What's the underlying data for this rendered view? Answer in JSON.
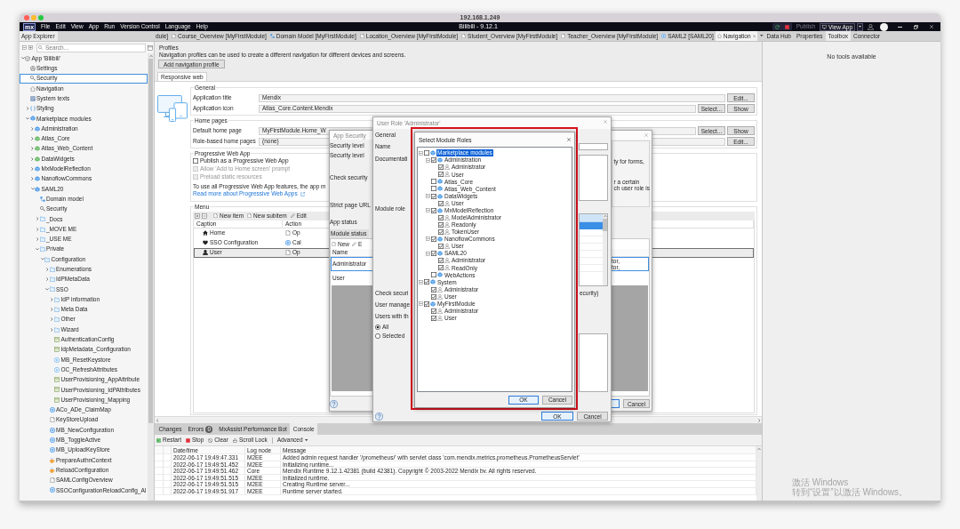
{
  "window": {
    "title": "192.168.1.249"
  },
  "menu_bar": {
    "logo": "mx",
    "items": [
      "File",
      "Edit",
      "View",
      "App",
      "Run",
      "Version Control",
      "Language",
      "Help"
    ],
    "app_title": "Bilibili - 9.12.1",
    "publish": {
      "label": "Publish",
      "disabled": true
    },
    "view_app": "View App"
  },
  "app_explorer": {
    "title": "App Explorer",
    "search": {
      "placeholder": "Search..."
    },
    "tree": [
      {
        "label": "App 'Bilibili'",
        "kind": "app",
        "expanded": true,
        "selected": false,
        "children": [
          {
            "label": "Settings",
            "kind": "settings",
            "selected": false
          },
          {
            "label": "Security",
            "kind": "security",
            "selected": true
          },
          {
            "label": "Navigation",
            "kind": "navigation",
            "selected": false
          },
          {
            "label": "System texts",
            "kind": "texts",
            "selected": false
          },
          {
            "label": "Styling",
            "kind": "styling",
            "expanded": false,
            "selected": false
          },
          {
            "label": "Marketplace modules",
            "kind": "module",
            "expanded": true,
            "selected": false,
            "children": [
              {
                "label": "Administration",
                "kind": "module",
                "expanded": false,
                "selected": false
              },
              {
                "label": "Atlas_Core",
                "kind": "uimodule",
                "expanded": false,
                "selected": false
              },
              {
                "label": "Atlas_Web_Content",
                "kind": "uimodule",
                "expanded": false,
                "selected": false
              },
              {
                "label": "DataWidgets",
                "kind": "uimodule",
                "expanded": false,
                "selected": false
              },
              {
                "label": "MxModelReflection",
                "kind": "module",
                "expanded": false,
                "selected": false
              },
              {
                "label": "NanoflowCommons",
                "kind": "module",
                "expanded": false,
                "selected": false
              },
              {
                "label": "SAML20",
                "kind": "module",
                "expanded": true,
                "selected": false,
                "children": [
                  {
                    "label": "Domain model",
                    "kind": "domain",
                    "selected": false
                  },
                  {
                    "label": "Security",
                    "kind": "security",
                    "selected": false
                  },
                  {
                    "label": "_Docs",
                    "kind": "folder",
                    "expanded": false,
                    "selected": false
                  },
                  {
                    "label": "_MOVE ME",
                    "kind": "folder",
                    "expanded": false,
                    "selected": false
                  },
                  {
                    "label": "_USE ME",
                    "kind": "folder",
                    "expanded": false,
                    "selected": false
                  },
                  {
                    "label": "Private",
                    "kind": "folder",
                    "expanded": true,
                    "selected": false,
                    "children": [
                      {
                        "label": "Configuration",
                        "kind": "folder",
                        "expanded": true,
                        "selected": false,
                        "children": [
                          {
                            "label": "Enumerations",
                            "kind": "folder",
                            "expanded": false,
                            "selected": false
                          },
                          {
                            "label": "IdPMetaData",
                            "kind": "folder",
                            "expanded": false,
                            "selected": false
                          },
                          {
                            "label": "SSO",
                            "kind": "folder",
                            "expanded": true,
                            "selected": false,
                            "children": [
                              {
                                "label": "IdP information",
                                "kind": "folder",
                                "expanded": false,
                                "selected": false
                              },
                              {
                                "label": "Meta Data",
                                "kind": "folder",
                                "expanded": false,
                                "selected": false
                              },
                              {
                                "label": "Other",
                                "kind": "folder",
                                "expanded": false,
                                "selected": false
                              },
                              {
                                "label": "Wizard",
                                "kind": "folder",
                                "expanded": false,
                                "selected": false
                              },
                              {
                                "label": "AuthenticationConfig",
                                "kind": "snippet",
                                "selected": false
                              },
                              {
                                "label": "IdpMetadata_Configuration",
                                "kind": "snippet",
                                "selected": false
                              },
                              {
                                "label": "MB_ResetKeystore",
                                "kind": "nanoflow",
                                "selected": false
                              },
                              {
                                "label": "OC_RefreshAttributes",
                                "kind": "nanoflow",
                                "selected": false
                              },
                              {
                                "label": "UserProvisioning_AppAttribute",
                                "kind": "snippet",
                                "selected": false
                              },
                              {
                                "label": "UserProvisioning_IdPAttributes",
                                "kind": "snippet",
                                "selected": false
                              },
                              {
                                "label": "UserProvisioning_Mapping",
                                "kind": "snippet",
                                "selected": false
                              }
                            ]
                          },
                          {
                            "label": "ACo_ADe_ClaimMap",
                            "kind": "microflow",
                            "selected": false
                          },
                          {
                            "label": "KeyStoreUpload",
                            "kind": "page",
                            "selected": false
                          },
                          {
                            "label": "MB_NewConfiguration",
                            "kind": "microflow",
                            "selected": false
                          },
                          {
                            "label": "MB_ToggleActive",
                            "kind": "microflow",
                            "selected": false
                          },
                          {
                            "label": "MB_UploadKeyStore",
                            "kind": "microflow",
                            "selected": false
                          },
                          {
                            "label": "PrepareAuthnContext",
                            "kind": "java",
                            "selected": false
                          },
                          {
                            "label": "ReloadConfiguration",
                            "kind": "java",
                            "selected": false
                          },
                          {
                            "label": "SAMLConfigOverview",
                            "kind": "page",
                            "selected": false
                          },
                          {
                            "label": "SSOConfigurationReloadConfig_Al",
                            "kind": "microflow",
                            "selected": false
                          }
                        ]
                      }
                    ]
                  }
                ]
              }
            ]
          }
        ]
      }
    ]
  },
  "document_tabs": [
    {
      "label": "dule]",
      "kind": "none",
      "selected": false
    },
    {
      "label": "Course_Overview [MyFirstModule]",
      "kind": "page",
      "selected": false
    },
    {
      "label": "Domain Model [MyFirstModule]",
      "kind": "domain",
      "selected": false
    },
    {
      "label": "Location_Overview [MyFirstModule]",
      "kind": "page",
      "selected": false
    },
    {
      "label": "Student_Overview [MyFirstModule]",
      "kind": "page",
      "selected": false
    },
    {
      "label": "Teacher_Overview [MyFirstModule]",
      "kind": "page",
      "selected": false
    },
    {
      "label": "SAML2 [SAML20]",
      "kind": "microflow",
      "selected": false
    },
    {
      "label": "Navigation",
      "kind": "navigation",
      "selected": true
    }
  ],
  "side_tabs": [
    {
      "label": "Data Hub",
      "selected": false
    },
    {
      "label": "Properties",
      "selected": false
    },
    {
      "label": "Toolbox",
      "selected": true
    },
    {
      "label": "Connector",
      "selected": false
    }
  ],
  "toolbox": {
    "empty_text": "No tools available"
  },
  "navigation": {
    "title": "Profiles",
    "description": "Navigation profiles can be used to create a different navigation for different devices and screens.",
    "add_button": "Add navigation profile",
    "tabs": [
      {
        "label": "Responsive web",
        "selected": true
      }
    ],
    "general": {
      "title": "General",
      "rows": [
        {
          "label": "Application title",
          "value": "Mendix",
          "buttons": [
            "Edit..."
          ]
        },
        {
          "label": "Application icon",
          "value": "Atlas_Core.Content.Mendix",
          "buttons": [
            "Select...",
            "Show"
          ]
        }
      ]
    },
    "home_pages": {
      "title": "Home pages",
      "rows": [
        {
          "label": "Default home page",
          "value": "MyFirstModule.Home_W",
          "buttons": [
            "Select...",
            "Show"
          ]
        },
        {
          "label": "Role-based home pages",
          "value": "(none)",
          "buttons": [
            "Edit..."
          ]
        }
      ]
    },
    "pwa": {
      "title": "Progressive Web App",
      "options": [
        {
          "label": "Publish as a Progressive Web App",
          "checked": false,
          "disabled": false
        },
        {
          "label": "Allow 'Add to Home screen' prompt",
          "checked": false,
          "disabled": true
        },
        {
          "label": "Preload static resources",
          "checked": false,
          "disabled": true
        }
      ],
      "note": "To use all Progressive Web App features, the app m",
      "link": "Read more about Progressive Web Apps"
    },
    "menu": {
      "title": "Menu",
      "toolbar": [
        {
          "label": "New item",
          "kind": "new"
        },
        {
          "label": "New subitem",
          "kind": "new"
        },
        {
          "label": "Edit",
          "kind": "edit"
        }
      ],
      "columns": [
        "Caption",
        "Action"
      ],
      "rows": [
        {
          "caption": "Home",
          "kind": "home",
          "action": {
            "label": "Op",
            "kind": "page"
          },
          "selected": false
        },
        {
          "caption": "SSO Configuration",
          "kind": "heart",
          "action": {
            "label": "Cal",
            "kind": "microflow"
          },
          "selected": false
        },
        {
          "caption": "User",
          "kind": "user",
          "action": {
            "label": "Op",
            "kind": "page"
          },
          "selected": true
        }
      ]
    }
  },
  "console": {
    "tabs": [
      {
        "label": "Changes",
        "selected": false
      },
      {
        "label": "Errors",
        "badge": "0",
        "selected": false
      },
      {
        "label": "MxAssist Performance Bot",
        "selected": false
      },
      {
        "label": "Console",
        "selected": true
      }
    ],
    "toolbar": [
      {
        "label": "Restart",
        "kind": "restart"
      },
      {
        "label": "Stop",
        "kind": "stop"
      },
      {
        "label": "Clear",
        "kind": "clear"
      },
      {
        "label": "Scroll Lock",
        "kind": "lock"
      },
      {
        "label": "Advanced",
        "kind": "dropdown"
      }
    ],
    "columns": [
      "Date/time",
      "Log node",
      "Message"
    ],
    "rows": [
      {
        "time": "2022-06-17 19:49:47.331",
        "node": "M2EE",
        "message": "Added admin request handler '/prometheus/' with servlet class 'com.mendix.metrics.prometheus.PrometheusServlet'"
      },
      {
        "time": "2022-06-17 19:49:51.452",
        "node": "M2EE",
        "message": "Initializing runtime..."
      },
      {
        "time": "2022-06-17 19:49:51.462",
        "node": "Core",
        "message": "Mendix Runtime 9.12.1.42381 (build 42381). Copyright © 2003-2022 Mendix bv. All rights reserved."
      },
      {
        "time": "2022-06-17 19:49:51.515",
        "node": "M2EE",
        "message": "Initialized runtime."
      },
      {
        "time": "2022-06-17 19:49:51.515",
        "node": "M2EE",
        "message": "Creating Runtime server..."
      },
      {
        "time": "2022-06-17 19:49:51.917",
        "node": "M2EE",
        "message": "Runtime server started."
      }
    ]
  },
  "app_security_dialog": {
    "title": "App Security",
    "labels": [
      "Security level",
      "Security level",
      "Check security",
      "Strict page URL",
      "App status"
    ],
    "notes": [
      "ty for forms,",
      "r a certain",
      "ch user role is"
    ],
    "section": "Module status",
    "toolbar": [
      {
        "label": "New",
        "kind": "new"
      },
      {
        "label": "E",
        "kind": "edit"
      }
    ],
    "column": "Name",
    "rows": [
      {
        "name": "Administrator",
        "roles": [
          "tor,",
          "tor,"
        ],
        "selected": true
      },
      {
        "name": "User",
        "selected": false
      }
    ],
    "buttons": [
      {
        "default": true
      },
      {
        "label": "Cancel",
        "default": false
      }
    ]
  },
  "user_role_dialog": {
    "title": "User Role 'Administrator'",
    "labels": [
      "General",
      "Name",
      "Documentati",
      "Module role",
      "Check securi",
      "User manage",
      "Users with th"
    ],
    "note": "ecurity)",
    "radios": [
      {
        "label": "All",
        "selected": true
      },
      {
        "label": "Selected",
        "selected": false
      }
    ],
    "buttons": [
      {
        "label": "OK",
        "default": true
      },
      {
        "label": "Cancel",
        "default": false
      }
    ]
  },
  "select_roles_dialog": {
    "title": "Select Module Roles",
    "tree": [
      {
        "label": "Marketplace modules",
        "kind": "module",
        "checked": false,
        "selected": true,
        "expanded": true,
        "children": [
          {
            "label": "Administration",
            "kind": "module",
            "checked": true,
            "selected": false,
            "expanded": true,
            "children": [
              {
                "label": "Administrator",
                "kind": "role",
                "checked": true,
                "selected": false
              },
              {
                "label": "User",
                "kind": "role",
                "checked": true,
                "selected": false
              }
            ]
          },
          {
            "label": "Atlas_Core",
            "kind": "module",
            "checked": false,
            "selected": false
          },
          {
            "label": "Atlas_Web_Content",
            "kind": "module",
            "checked": false,
            "selected": false
          },
          {
            "label": "DataWidgets",
            "kind": "module",
            "checked": true,
            "selected": false,
            "expanded": true,
            "children": [
              {
                "label": "User",
                "kind": "role",
                "checked": true,
                "selected": false
              }
            ]
          },
          {
            "label": "MxModelReflection",
            "kind": "module",
            "checked": true,
            "selected": false,
            "expanded": true,
            "children": [
              {
                "label": "ModelAdministrator",
                "kind": "role",
                "checked": true,
                "selected": false
              },
              {
                "label": "Readonly",
                "kind": "role",
                "checked": true,
                "selected": false
              },
              {
                "label": "TokenUser",
                "kind": "role",
                "checked": true,
                "selected": false
              }
            ]
          },
          {
            "label": "NanoflowCommons",
            "kind": "module",
            "checked": true,
            "selected": false,
            "expanded": true,
            "children": [
              {
                "label": "User",
                "kind": "role",
                "checked": true,
                "selected": false
              }
            ]
          },
          {
            "label": "SAML20",
            "kind": "module",
            "checked": true,
            "selected": false,
            "expanded": true,
            "children": [
              {
                "label": "Administrator",
                "kind": "role",
                "checked": true,
                "selected": false
              },
              {
                "label": "ReadOnly",
                "kind": "role",
                "checked": true,
                "selected": false
              }
            ]
          },
          {
            "label": "WebActions",
            "kind": "module",
            "checked": false,
            "selected": false
          }
        ]
      },
      {
        "label": "System",
        "kind": "module",
        "checked": true,
        "selected": false,
        "expanded": true,
        "children": [
          {
            "label": "Administrator",
            "kind": "role",
            "checked": true,
            "selected": false
          },
          {
            "label": "User",
            "kind": "role",
            "checked": true,
            "selected": false
          }
        ]
      },
      {
        "label": "MyFirstModule",
        "kind": "module",
        "checked": true,
        "selected": false,
        "expanded": true,
        "children": [
          {
            "label": "Administrator",
            "kind": "role",
            "checked": true,
            "selected": false
          },
          {
            "label": "User",
            "kind": "role",
            "checked": true,
            "selected": false
          }
        ]
      }
    ],
    "buttons": [
      {
        "label": "OK",
        "default": true
      },
      {
        "label": "Cancel",
        "default": false
      }
    ]
  },
  "activation_notice": {
    "lines": [
      "激活 Windows",
      "转到“设置”以激活 Windows。"
    ]
  }
}
